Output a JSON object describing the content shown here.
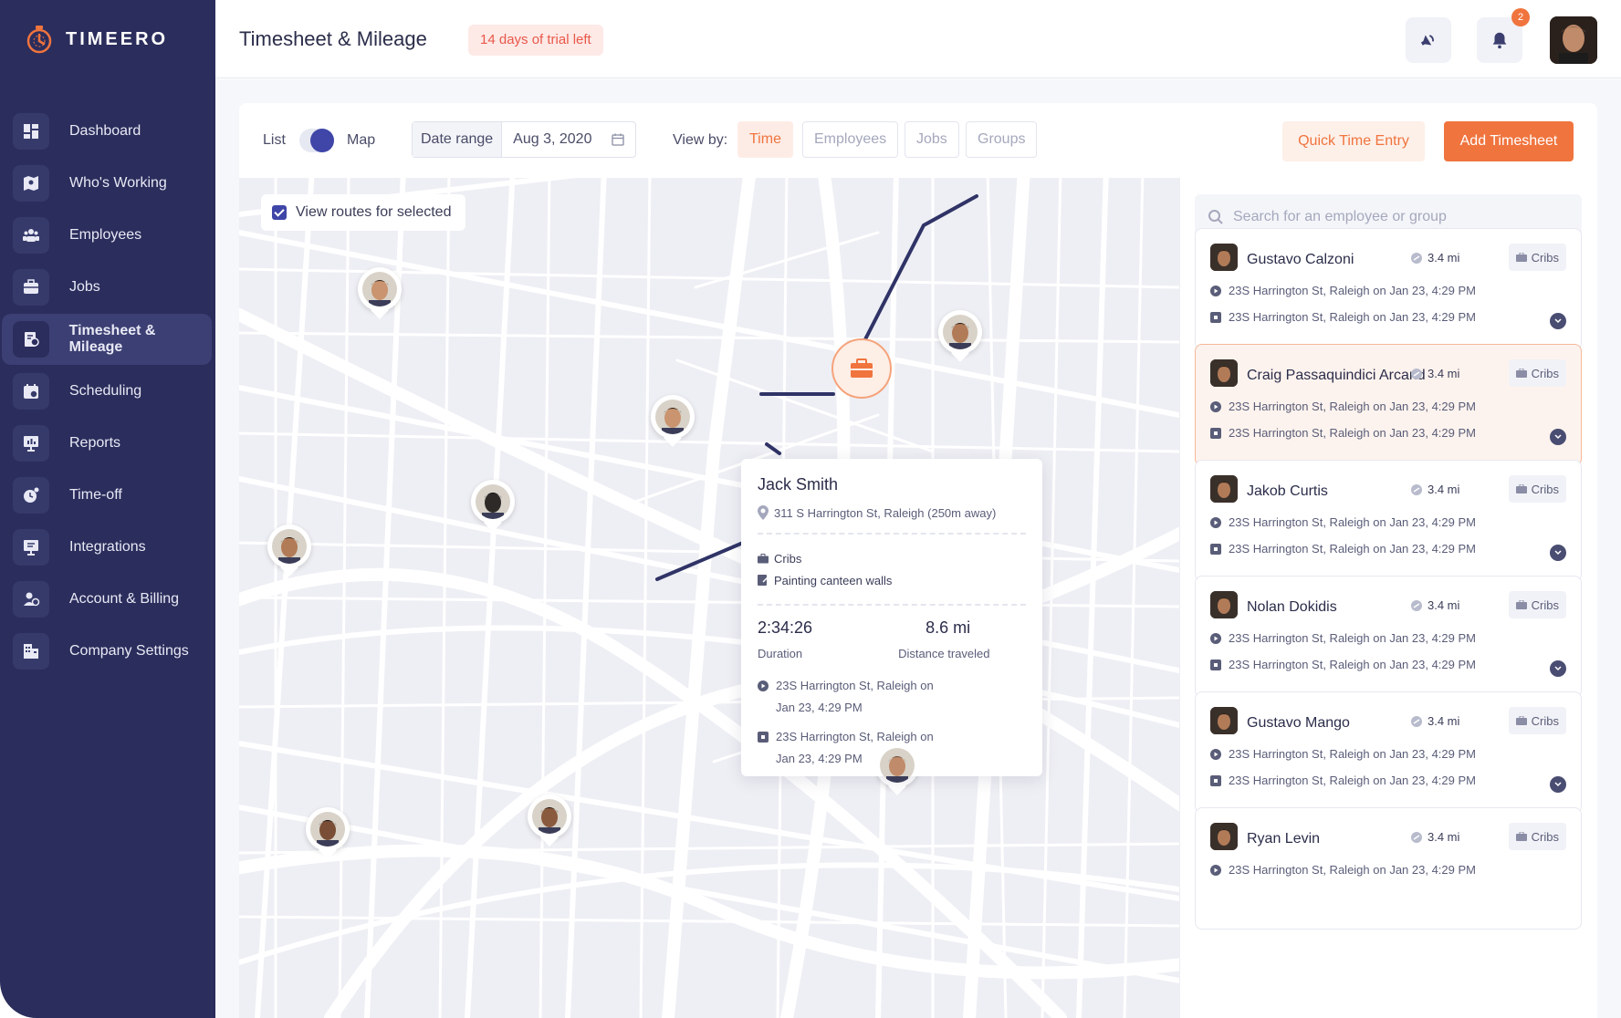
{
  "app": {
    "logo_text": "TIMEERO"
  },
  "sidebar": {
    "items": [
      {
        "label": "Dashboard",
        "icon": "dashboard-icon"
      },
      {
        "label": "Who's Working",
        "icon": "map-icon"
      },
      {
        "label": "Employees",
        "icon": "people-icon"
      },
      {
        "label": "Jobs",
        "icon": "briefcase-icon"
      },
      {
        "label": "Timesheet & Mileage",
        "icon": "timesheet-icon",
        "active": true
      },
      {
        "label": "Scheduling",
        "icon": "calendar-icon"
      },
      {
        "label": "Reports",
        "icon": "reports-icon"
      },
      {
        "label": "Time-off",
        "icon": "time-off-icon"
      },
      {
        "label": "Integrations",
        "icon": "integrations-icon"
      },
      {
        "label": "Account & Billing",
        "icon": "account-icon"
      },
      {
        "label": "Company Settings",
        "icon": "building-icon"
      }
    ]
  },
  "header": {
    "title": "Timesheet & Mileage",
    "trial_badge": "14 days of trial left",
    "notification_count": "2"
  },
  "toolbar": {
    "list_label": "List",
    "map_label": "Map",
    "date_range_label": "Date range",
    "date_value": "Aug 3, 2020",
    "view_by_label": "View by:",
    "view_options": [
      "Time",
      "Employees",
      "Jobs",
      "Groups"
    ],
    "view_active": "Time",
    "quick_time_entry": "Quick Time Entry",
    "add_timesheet": "Add Timesheet"
  },
  "map": {
    "view_routes_label": "View routes for selected",
    "view_routes_checked": true
  },
  "popup": {
    "name": "Jack Smith",
    "address": "311 S Harrington St, Raleigh (250m away)",
    "job": "Cribs",
    "task": "Painting canteen walls",
    "duration_value": "2:34:26",
    "duration_label": "Duration",
    "distance_value": "8.6 mi",
    "distance_label": "Distance traveled",
    "start_line1": "23S Harrington St, Raleigh on",
    "start_line2": "Jan 23, 4:29 PM",
    "end_line1": "23S Harrington St, Raleigh on",
    "end_line2": "Jan 23, 4:29 PM"
  },
  "list": {
    "search_placeholder": "Search for an employee or group",
    "employees": [
      {
        "name": "Gustavo Calzoni",
        "distance": "3.4 mi",
        "job": "Cribs",
        "start": "23S Harrington St, Raleigh on  Jan 23, 4:29 PM",
        "end": "23S Harrington St, Raleigh on  Jan 23, 4:29 PM"
      },
      {
        "name": "Craig Passaquindici Arcand",
        "distance": "3.4 mi",
        "job": "Cribs",
        "start": "23S Harrington St, Raleigh on  Jan 23, 4:29 PM",
        "end": "23S Harrington St, Raleigh on  Jan 23, 4:29 PM",
        "selected": true
      },
      {
        "name": "Jakob Curtis",
        "distance": "3.4 mi",
        "job": "Cribs",
        "start": "23S Harrington St, Raleigh on  Jan 23, 4:29 PM",
        "end": "23S Harrington St, Raleigh on  Jan 23, 4:29 PM"
      },
      {
        "name": "Nolan Dokidis",
        "distance": "3.4 mi",
        "job": "Cribs",
        "start": "23S Harrington St, Raleigh on  Jan 23, 4:29 PM",
        "end": "23S Harrington St, Raleigh on  Jan 23, 4:29 PM"
      },
      {
        "name": "Gustavo Mango",
        "distance": "3.4 mi",
        "job": "Cribs",
        "start": "23S Harrington St, Raleigh on  Jan 23, 4:29 PM",
        "end": "23S Harrington St, Raleigh on  Jan 23, 4:29 PM"
      },
      {
        "name": "Ryan Levin",
        "distance": "3.4 mi",
        "job": "Cribs",
        "start": "23S Harrington St, Raleigh on  Jan 23, 4:29 PM",
        "end": ""
      }
    ]
  },
  "colors": {
    "sidebar_bg": "#2b2d5c",
    "accent": "#f0743e",
    "primary": "#3f46a8",
    "route": "#2f3366"
  }
}
